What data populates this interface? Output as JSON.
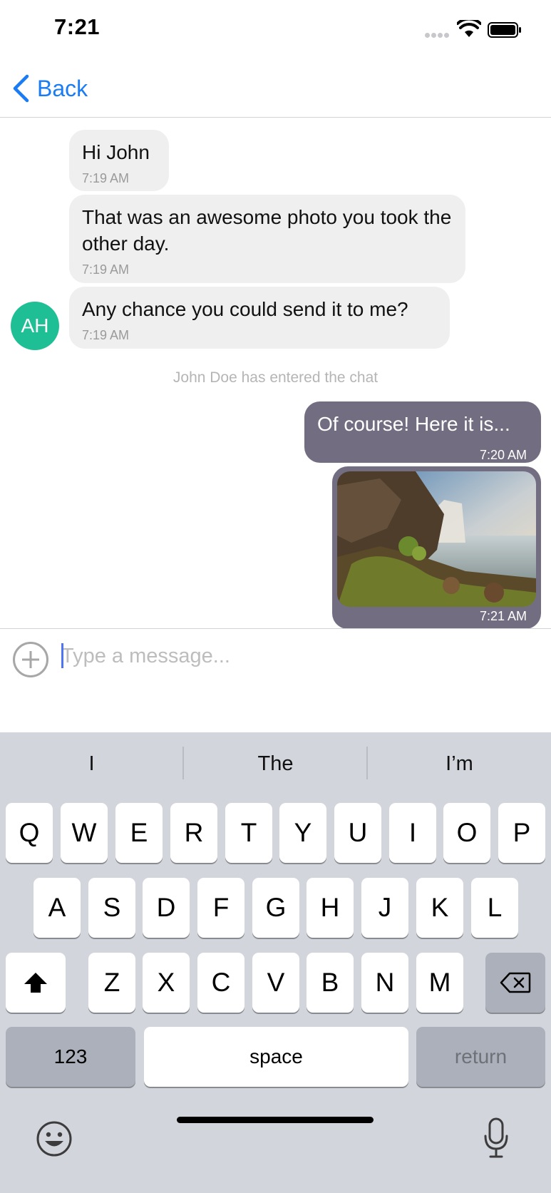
{
  "status_bar": {
    "time": "7:21"
  },
  "nav": {
    "back_label": "Back"
  },
  "messages": [
    {
      "text": "Hi John",
      "time": "7:19 AM",
      "direction": "incoming"
    },
    {
      "text": "That was an awesome photo you took the other day.",
      "time": "7:19 AM",
      "direction": "incoming"
    },
    {
      "text": "Any chance you could send it to me?",
      "time": "7:19 AM",
      "direction": "incoming"
    },
    {
      "text": "Of course! Here it is...",
      "time": "7:20 AM",
      "direction": "outgoing"
    },
    {
      "image": "waterfall-photo",
      "time": "7:21 AM",
      "direction": "outgoing"
    }
  ],
  "avatar": {
    "initials": "AH",
    "color": "#1fbf95"
  },
  "system_message": "John Doe has entered the chat",
  "composer": {
    "placeholder": "Type a message...",
    "value": ""
  },
  "keyboard": {
    "suggestions": [
      "I",
      "The",
      "I’m"
    ],
    "row1": [
      "Q",
      "W",
      "E",
      "R",
      "T",
      "Y",
      "U",
      "I",
      "O",
      "P"
    ],
    "row2": [
      "A",
      "S",
      "D",
      "F",
      "G",
      "H",
      "J",
      "K",
      "L"
    ],
    "row3": [
      "Z",
      "X",
      "C",
      "V",
      "B",
      "N",
      "M"
    ],
    "numbers_label": "123",
    "space_label": "space",
    "return_label": "return",
    "shift_icon": "shift-icon",
    "delete_icon": "delete-icon",
    "emoji_icon": "emoji-icon",
    "mic_icon": "microphone-icon"
  },
  "colors": {
    "accent": "#1a7cf5",
    "incoming_bubble": "#efefef",
    "outgoing_bubble": "#736d82",
    "keyboard_bg": "#d2d5dc"
  }
}
